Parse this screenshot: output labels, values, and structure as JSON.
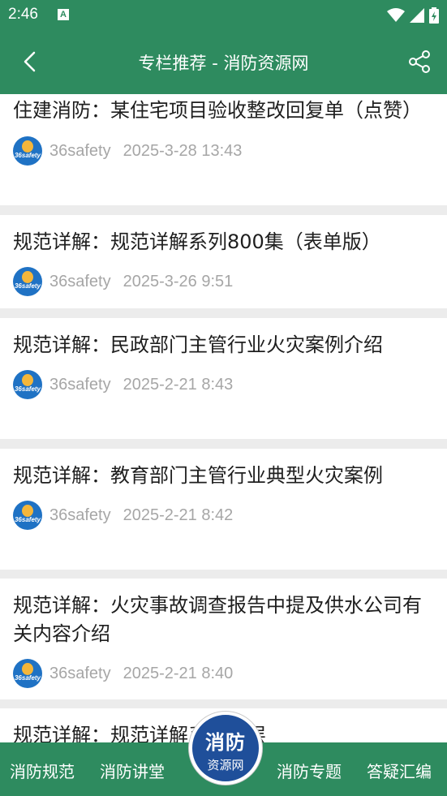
{
  "status_bar": {
    "time": "2:46",
    "a_icon": "A"
  },
  "app_bar": {
    "title": "专栏推荐 - 消防资源网"
  },
  "articles": [
    {
      "title": "住建消防：某住宅项目验收整改回复单（点赞）",
      "author": "36safety",
      "date": "2025-3-28 13:43"
    },
    {
      "title": "规范详解：规范详解系列800集（表单版）",
      "author": "36safety",
      "date": "2025-3-26 9:51"
    },
    {
      "title": "规范详解：民政部门主管行业火灾案例介绍",
      "author": "36safety",
      "date": "2025-2-21 8:43"
    },
    {
      "title": "规范详解：教育部门主管行业典型火灾案例",
      "author": "36safety",
      "date": "2025-2-21 8:42"
    },
    {
      "title": "规范详解：火灾事故调查报告中提及供水公司有关内容介绍",
      "author": "36safety",
      "date": "2025-2-21 8:40"
    },
    {
      "title": "规范详解：规范详解系列空层"
    }
  ],
  "logo_text": "36safety",
  "bottom_nav": {
    "item1": "消防规范",
    "item2": "消防讲堂",
    "center_line1": "消防",
    "center_line2": "资源网",
    "item3": "消防专题",
    "item4": "答疑汇编"
  },
  "colors": {
    "brand_green": "#2e8b5f",
    "center_blue": "#1f4f9a",
    "meta_gray": "#a6a6a6"
  }
}
